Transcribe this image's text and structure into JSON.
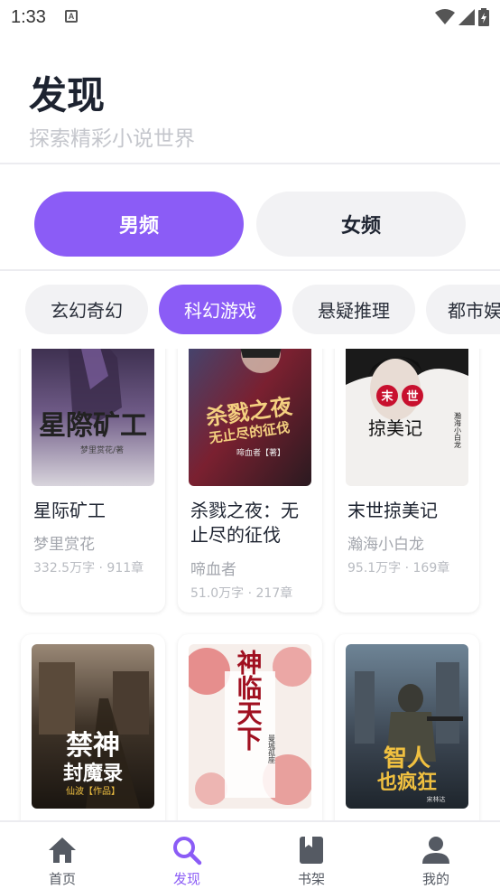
{
  "status_bar": {
    "time": "1:33",
    "notification_icon": "A"
  },
  "header": {
    "title": "发现",
    "subtitle": "探索精彩小说世界"
  },
  "gender_tabs": [
    {
      "label": "男频",
      "active": true
    },
    {
      "label": "女频",
      "active": false
    }
  ],
  "categories": [
    {
      "label": "玄幻奇幻",
      "active": false
    },
    {
      "label": "科幻游戏",
      "active": true
    },
    {
      "label": "悬疑推理",
      "active": false
    },
    {
      "label": "都市娱乐",
      "active": false
    }
  ],
  "books": [
    {
      "title": "星际矿工",
      "author": "梦里赏花",
      "meta": "332.5万字 · 911章",
      "cover_text": "星際矿工",
      "cover_sub": "梦里赏花/著"
    },
    {
      "title": "杀戮之夜：无止尽的征伐",
      "author": "啼血者",
      "meta": "51.0万字 · 217章",
      "cover_text": "杀戮之夜",
      "cover_sub": "无止尽的征伐",
      "cover_sub2": "啼血者【著】"
    },
    {
      "title": "末世掠美记",
      "author": "瀚海小白龙",
      "meta": "95.1万字 · 169章",
      "cover_badge_1": "末",
      "cover_badge_2": "世",
      "cover_text": "掠美记",
      "cover_side": "瀚海小白龙"
    },
    {
      "title": "",
      "author": "",
      "meta": "",
      "cover_text": "禁神",
      "cover_text2": "封魔录",
      "cover_sub": "仙波【作品】"
    },
    {
      "title": "",
      "author": "",
      "meta": "",
      "cover_text": "神临天下",
      "cover_side": "曼城孤座"
    },
    {
      "title": "",
      "author": "",
      "meta": "",
      "cover_text": "智人",
      "cover_text2": "也疯狂",
      "cover_sub": "宋林达"
    }
  ],
  "bottom_nav": [
    {
      "label": "首页",
      "icon": "home-icon",
      "active": false
    },
    {
      "label": "发现",
      "icon": "search-icon",
      "active": true
    },
    {
      "label": "书架",
      "icon": "bookshelf-icon",
      "active": false
    },
    {
      "label": "我的",
      "icon": "profile-icon",
      "active": false
    }
  ],
  "colors": {
    "accent": "#8b5cf6",
    "chip_bg": "#f2f2f4",
    "muted_text": "#a3a6ad"
  }
}
